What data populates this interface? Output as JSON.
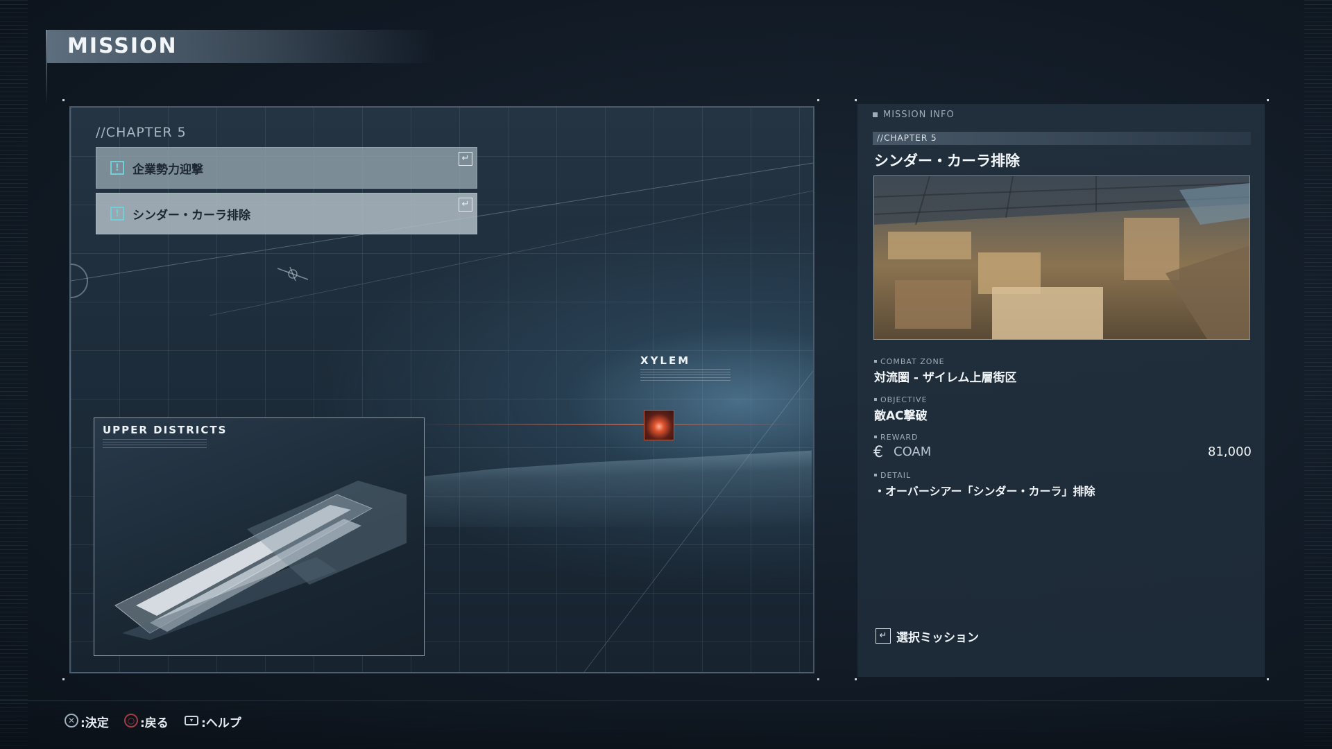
{
  "header": {
    "title": "MISSION"
  },
  "mission_list": {
    "chapter": "//CHAPTER 5",
    "items": [
      {
        "name": "企業勢力迎撃",
        "status_icon": "exclamation-icon",
        "selected": false
      },
      {
        "name": "シンダー・カーラ排除",
        "status_icon": "exclamation-icon",
        "selected": true
      }
    ]
  },
  "map": {
    "location_label": "XYLEM",
    "marker": "mission-area-marker",
    "minimap_title": "UPPER DISTRICTS"
  },
  "mission_info": {
    "section_title": "MISSION INFO",
    "chapter": "//CHAPTER 5",
    "title": "シンダー・カーラ排除",
    "combat_zone_label": "COMBAT ZONE",
    "combat_zone": "対流圏 - ザイレム上層街区",
    "objective_label": "OBJECTIVE",
    "objective": "敵AC撃破",
    "reward_label": "REWARD",
    "reward_currency": "COAM",
    "reward_amount": "81,000",
    "detail_label": "DETAIL",
    "detail": "・オーバーシアー「シンダー・カーラ」排除",
    "select_mission_label": "選択ミッション"
  },
  "footer": {
    "confirm": ":決定",
    "back": ":戻る",
    "help": ":ヘルプ"
  },
  "colors": {
    "accent_cyan": "#6fd0d8",
    "marker_red": "#e0542e",
    "back_button_red": "#a23c42"
  }
}
